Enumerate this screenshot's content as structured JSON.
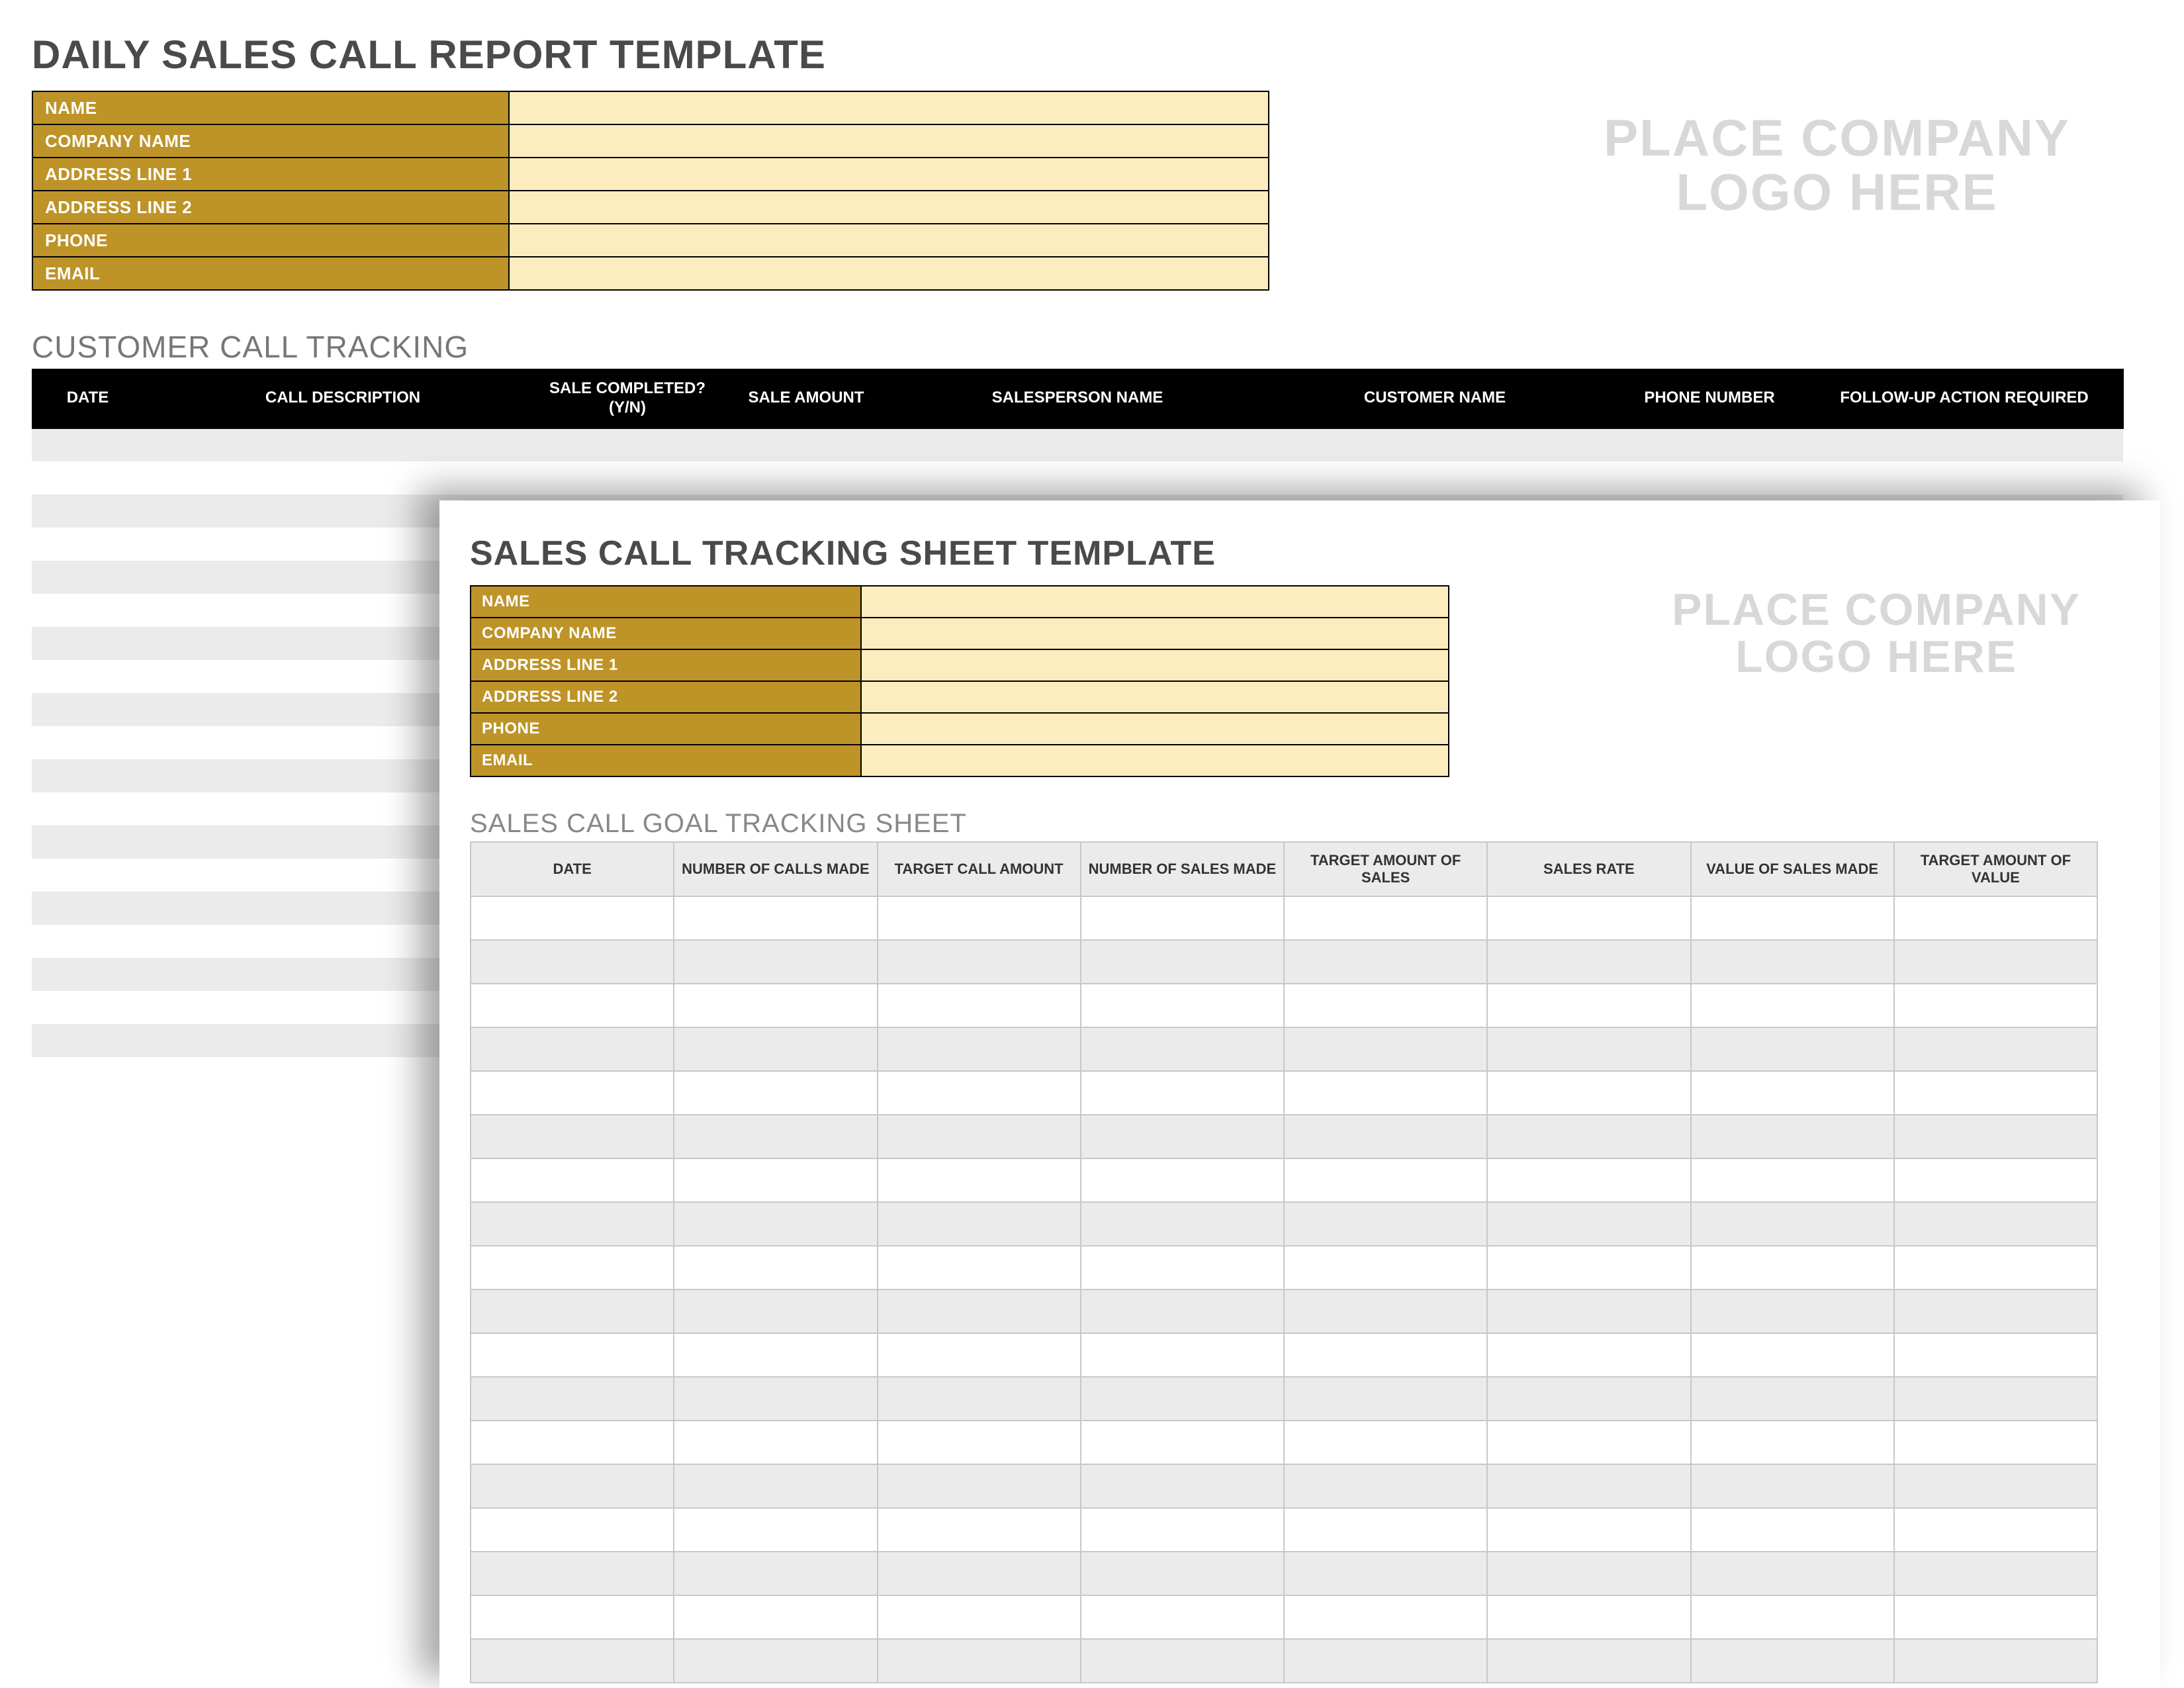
{
  "back": {
    "title": "DAILY SALES CALL REPORT TEMPLATE",
    "info_labels": [
      "NAME",
      "COMPANY NAME",
      "ADDRESS LINE 1",
      "ADDRESS LINE 2",
      "PHONE",
      "EMAIL"
    ],
    "info_values": [
      "",
      "",
      "",
      "",
      "",
      ""
    ],
    "logo_line1": "PLACE COMPANY",
    "logo_line2": "LOGO HERE",
    "subtitle": "CUSTOMER CALL TRACKING",
    "columns": [
      "DATE",
      "CALL DESCRIPTION",
      "SALE COMPLETED? (Y/N)",
      "SALE AMOUNT",
      "SALESPERSON NAME",
      "CUSTOMER NAME",
      "PHONE NUMBER",
      "FOLLOW-UP ACTION REQUIRED"
    ],
    "row_count": 20
  },
  "front": {
    "title": "SALES CALL TRACKING SHEET TEMPLATE",
    "info_labels": [
      "NAME",
      "COMPANY NAME",
      "ADDRESS LINE 1",
      "ADDRESS LINE 2",
      "PHONE",
      "EMAIL"
    ],
    "info_values": [
      "",
      "",
      "",
      "",
      "",
      ""
    ],
    "logo_line1": "PLACE COMPANY",
    "logo_line2": "LOGO HERE",
    "subtitle": "SALES CALL GOAL TRACKING SHEET",
    "columns": [
      "DATE",
      "NUMBER OF CALLS MADE",
      "TARGET CALL AMOUNT",
      "NUMBER OF SALES MADE",
      "TARGET AMOUNT OF SALES",
      "SALES RATE",
      "VALUE OF SALES MADE",
      "TARGET AMOUNT OF VALUE"
    ],
    "row_count": 18
  }
}
